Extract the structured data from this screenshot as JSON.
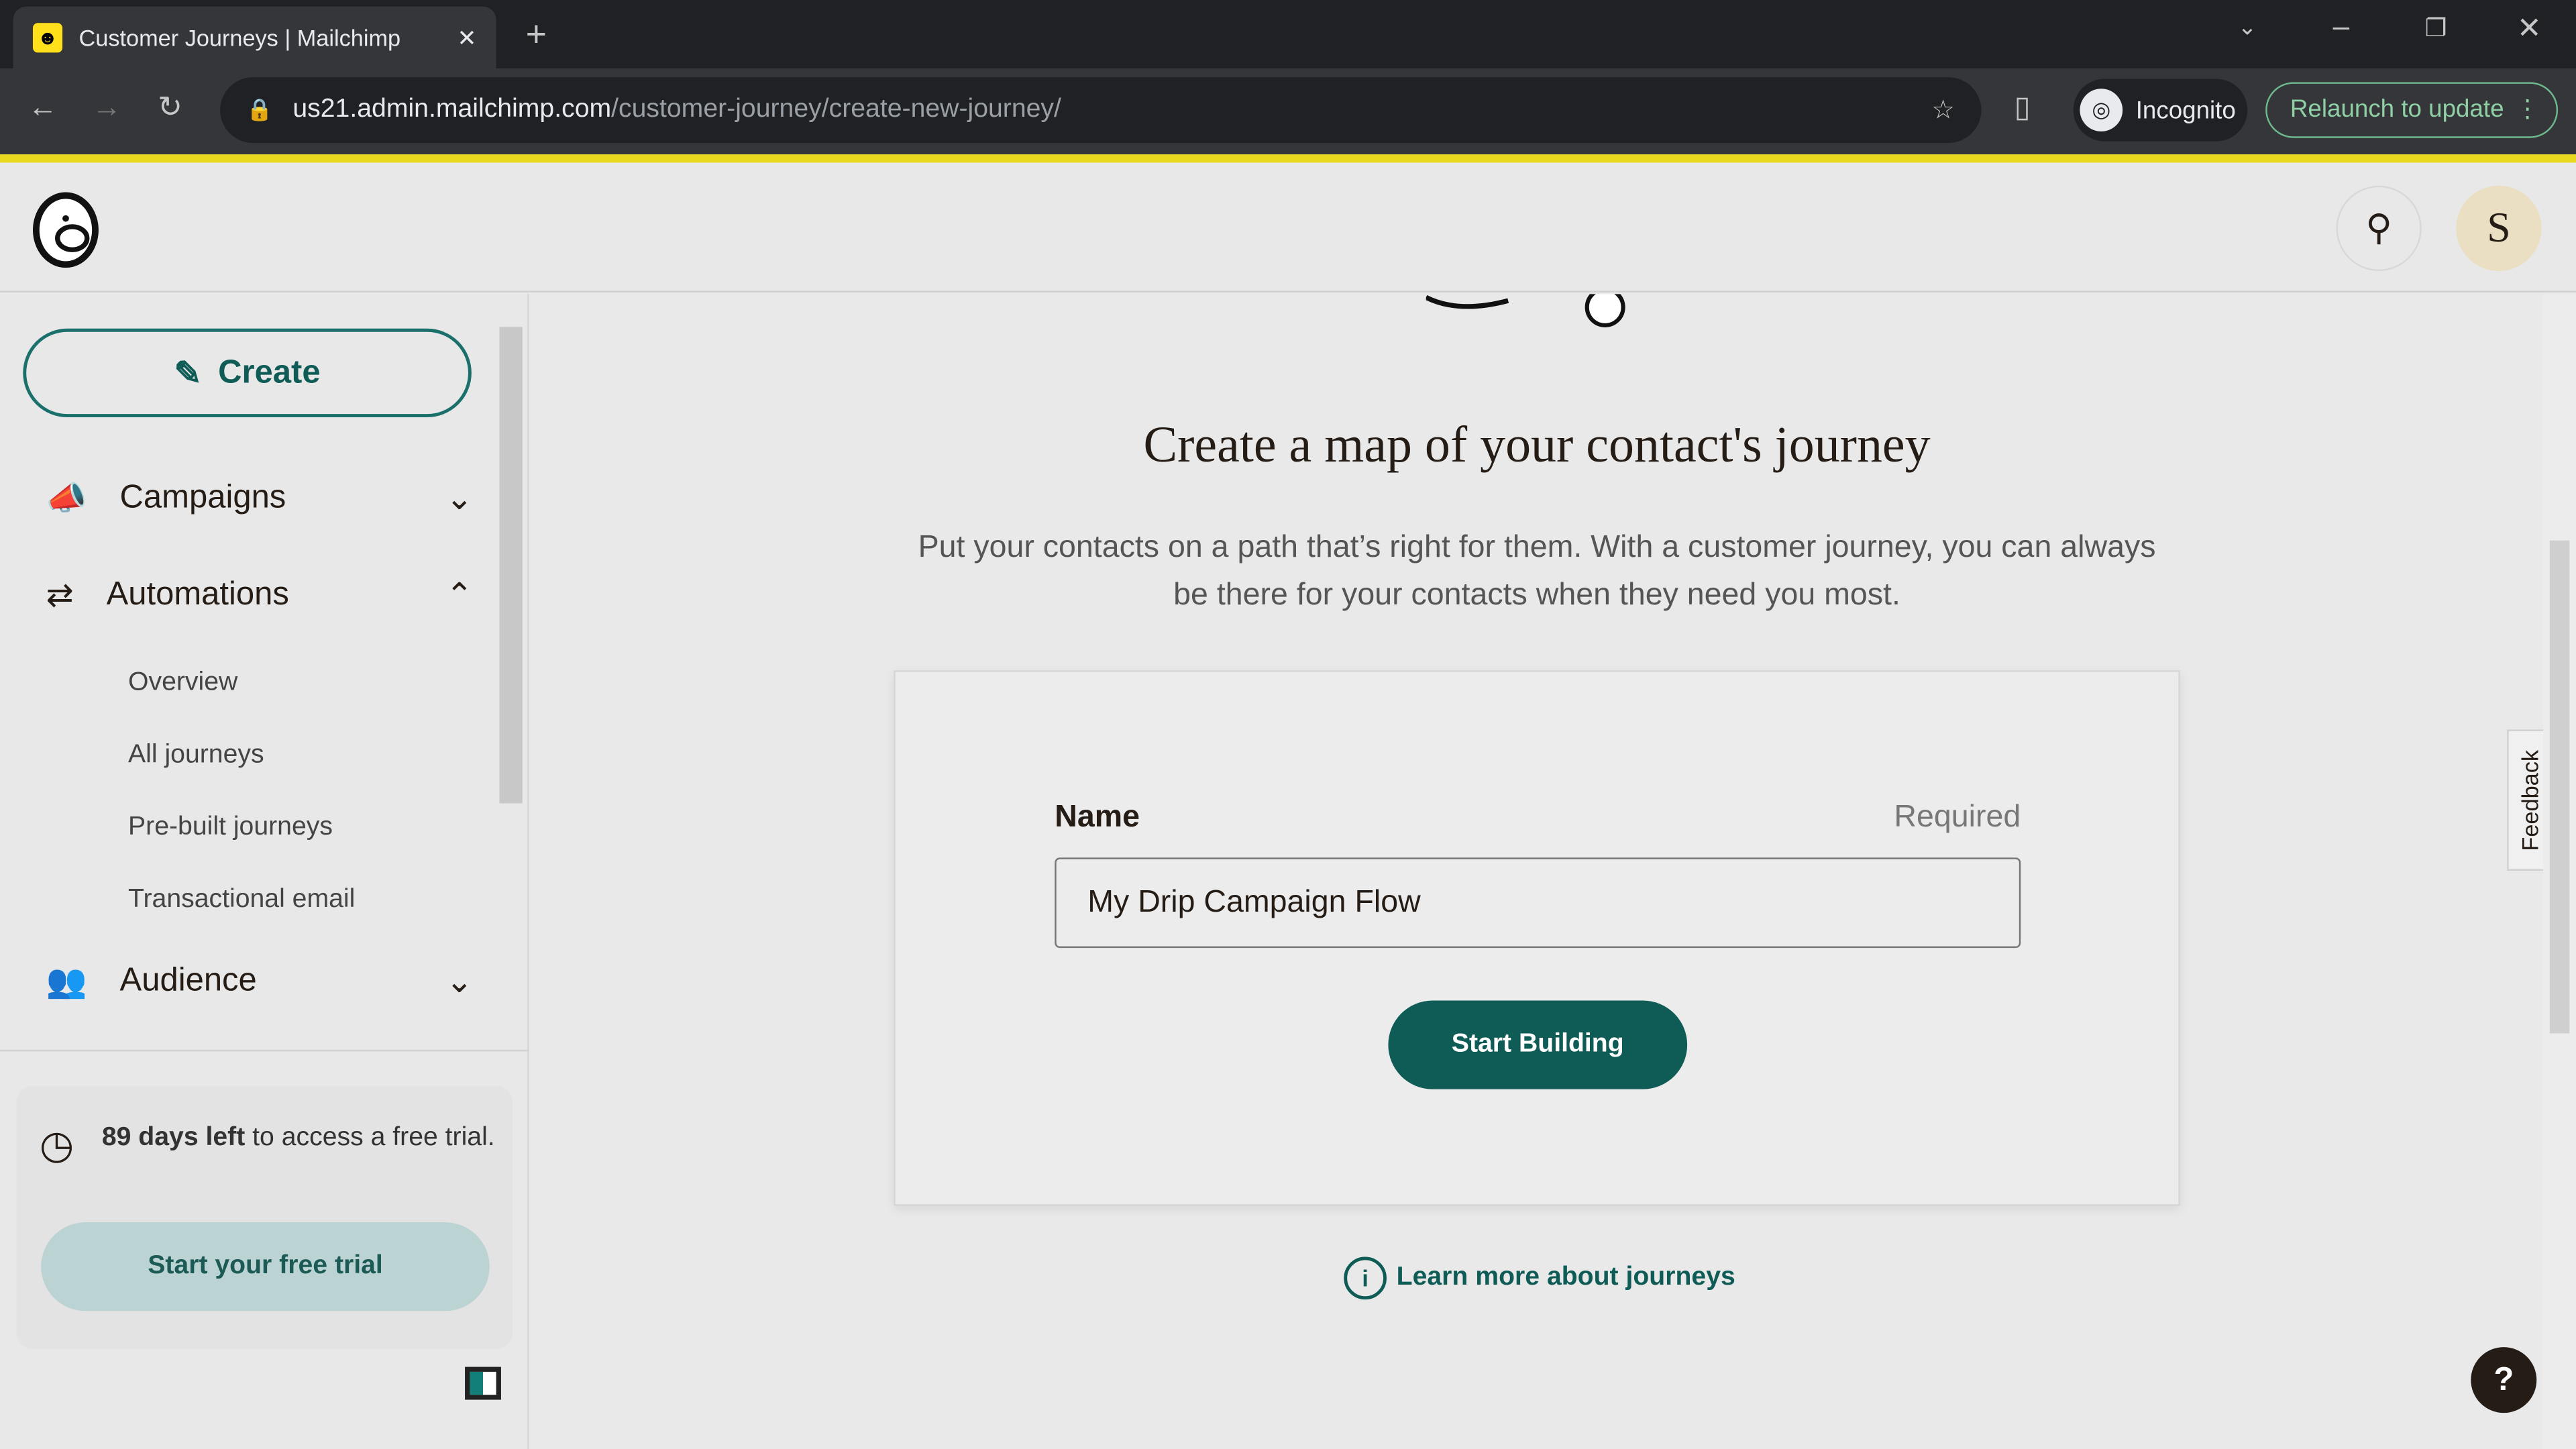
{
  "browser": {
    "tab_title": "Customer Journeys | Mailchimp",
    "url_host": "us21.admin.mailchimp.com",
    "url_path": "/customer-journey/create-new-journey/",
    "incognito_label": "Incognito",
    "relaunch_label": "Relaunch to update"
  },
  "header": {
    "avatar_initial": "S"
  },
  "sidebar": {
    "create_label": "Create",
    "items": [
      {
        "label": "Campaigns"
      },
      {
        "label": "Automations"
      },
      {
        "label": "Audience"
      }
    ],
    "sub_items": [
      {
        "label": "Overview"
      },
      {
        "label": "All journeys"
      },
      {
        "label": "Pre-built journeys"
      },
      {
        "label": "Transactional email"
      }
    ],
    "trial": {
      "days_bold": "89 days left",
      "rest": " to access a free trial.",
      "button": "Start your free trial"
    }
  },
  "main": {
    "title": "Create a map of your contact's journey",
    "description": "Put your contacts on a path that’s right for them. With a customer journey, you can always be there for your contacts when they need you most.",
    "form": {
      "name_label": "Name",
      "required_label": "Required",
      "name_value": "My Drip Campaign Flow",
      "submit": "Start Building"
    },
    "learn_more": "Learn more about journeys",
    "feedback": "Feedback",
    "help": "?"
  },
  "colors": {
    "brand_teal": "#0f5c57",
    "mailchimp_yellow": "#ffe01b"
  }
}
